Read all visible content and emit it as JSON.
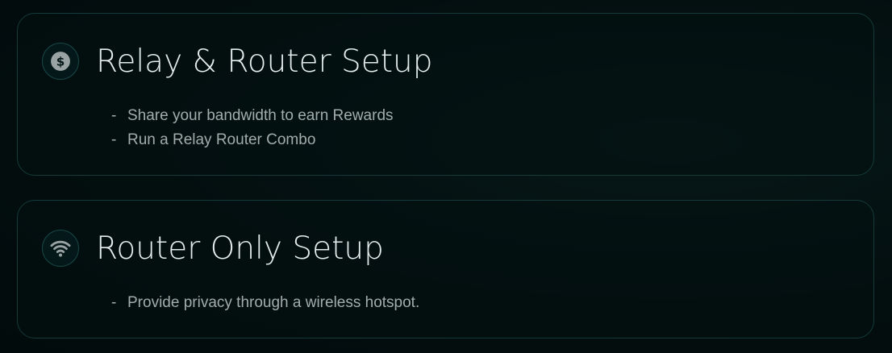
{
  "cards": [
    {
      "icon": "dollar-coin-icon",
      "title": "Relay & Router Setup",
      "bullets": [
        "Share your bandwidth to earn Rewards",
        "Run a Relay Router Combo"
      ]
    },
    {
      "icon": "wifi-icon",
      "title": "Router Only Setup",
      "bullets": [
        "Provide privacy through a wireless hotspot."
      ]
    }
  ],
  "bullet_marker": "-",
  "colors": {
    "background": "#030f10",
    "card_border": "#143a3a",
    "title": "#e4ecec",
    "bullet_text": "#a3acac",
    "icon": "#9aa3a3"
  }
}
